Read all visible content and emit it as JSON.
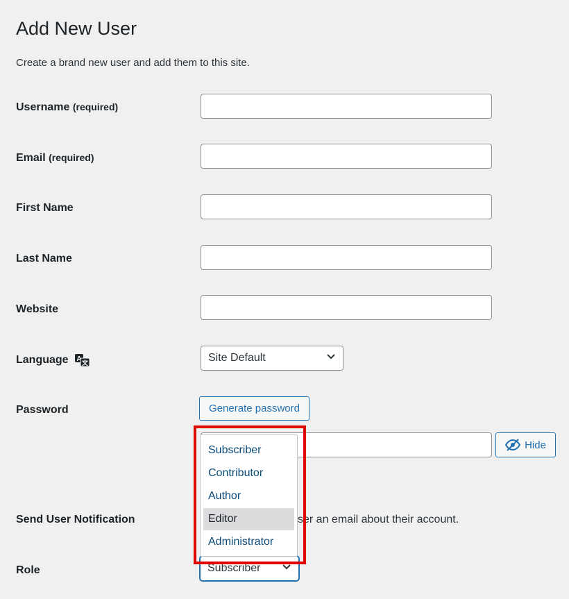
{
  "page": {
    "title": "Add New User",
    "description": "Create a brand new user and add them to this site."
  },
  "fields": {
    "username": {
      "label": "Username",
      "suffix": "(required)",
      "value": ""
    },
    "email": {
      "label": "Email",
      "suffix": "(required)",
      "value": ""
    },
    "first_name": {
      "label": "First Name",
      "value": ""
    },
    "last_name": {
      "label": "Last Name",
      "value": ""
    },
    "website": {
      "label": "Website",
      "value": ""
    },
    "language": {
      "label": "Language",
      "selected": "Site Default",
      "icon": "translation-icon"
    },
    "password": {
      "label": "Password",
      "generate_label": "Generate password",
      "hide_label": "Hide",
      "hide_icon": "eye-slash-icon"
    },
    "notification": {
      "label": "Send User Notification",
      "visible_text": "ser an email about their account."
    },
    "role": {
      "label": "Role",
      "selected": "Subscriber",
      "options": [
        "Subscriber",
        "Contributor",
        "Author",
        "Editor",
        "Administrator"
      ],
      "hovered": "Editor"
    }
  },
  "colors": {
    "accent": "#2271b1",
    "highlight": "#e00000",
    "option_text": "#0a4b78"
  }
}
